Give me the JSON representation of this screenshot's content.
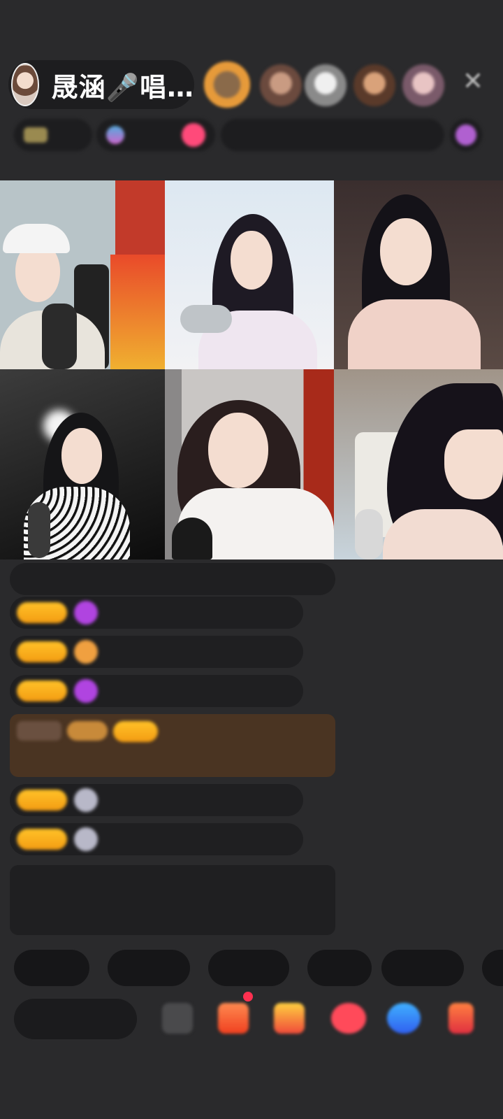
{
  "header": {
    "host_name": "晟涵🎤唱…",
    "host_avatar_icon": "host-avatar-icon",
    "viewers": [
      "viewer-avatar-1",
      "viewer-avatar-2",
      "viewer-avatar-3",
      "viewer-avatar-4",
      "viewer-avatar-5"
    ],
    "close_icon": "close-icon",
    "close_glyph": "✕"
  },
  "info_row": {
    "chip_1": "",
    "chip_2": "",
    "chip_3": "",
    "chip_4": ""
  },
  "grid": {
    "tiles": [
      {
        "label": ""
      },
      {
        "label": ""
      },
      {
        "label": ""
      },
      {
        "label": ""
      },
      {
        "label": ""
      },
      {
        "label": ""
      }
    ]
  },
  "chat": {
    "messages": [
      {
        "text": ""
      },
      {
        "text": ""
      },
      {
        "text": ""
      },
      {
        "text": ""
      },
      {
        "text": ""
      },
      {
        "text": ""
      },
      {
        "text": ""
      },
      {
        "text": ""
      }
    ]
  },
  "bottom": {
    "quick_replies": [
      "",
      "",
      "",
      "",
      "",
      ""
    ],
    "comment_placeholder": "",
    "tools": [
      "more-icon",
      "gift-box-icon",
      "gift-icon",
      "heart-icon",
      "game-icon",
      "share-icon"
    ]
  },
  "colors": {
    "background": "#2a2a2c",
    "badge_gold": "#f5b21a",
    "gem_purple": "#b044e0",
    "gem_orange": "#f0a040",
    "notice_green": "#7bc25a",
    "username_blue": "#4aa8d8"
  }
}
